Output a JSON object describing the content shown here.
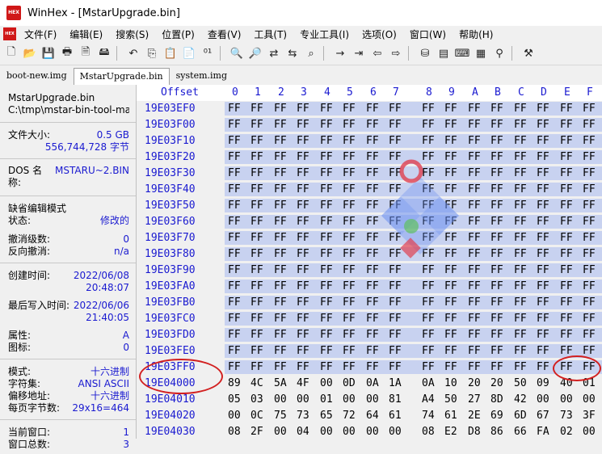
{
  "window": {
    "title": "WinHex - [MstarUpgrade.bin]",
    "icon_label": "HEX"
  },
  "menu": [
    "文件(F)",
    "编辑(E)",
    "搜索(S)",
    "位置(P)",
    "查看(V)",
    "工具(T)",
    "专业工具(I)",
    "选项(O)",
    "窗口(W)",
    "帮助(H)"
  ],
  "tabs": [
    {
      "label": "boot-new.img",
      "active": false
    },
    {
      "label": "MstarUpgrade.bin",
      "active": true
    },
    {
      "label": "system.img",
      "active": false
    }
  ],
  "info": {
    "filename": "MstarUpgrade.bin",
    "path": "C:\\tmp\\mstar-bin-tool-mas",
    "size_label": "文件大小:",
    "size_gb": "0.5 GB",
    "size_bytes": "556,744,728 字节",
    "dos_label": "DOS 名称:",
    "dos_value": "MSTARU~2.BIN",
    "edit_mode_label": "缺省编辑模式",
    "state_label": "状态:",
    "state_value": "修改的",
    "undo_label": "撤消级数:",
    "undo_value": "0",
    "redo_label": "反向撤消:",
    "redo_value": "n/a",
    "created_label": "创建时间:",
    "created_date": "2022/06/08",
    "created_time": "20:48:07",
    "modified_label": "最后写入时间:",
    "modified_date": "2022/06/06",
    "modified_time": "21:40:05",
    "attr_label": "属性:",
    "attr_value": "A",
    "icon_label": "图标:",
    "icon_value": "0",
    "mode_label": "模式:",
    "mode_value": "十六进制",
    "charset_label": "字符集:",
    "charset_value": "ANSI ASCII",
    "offset_label": "偏移地址:",
    "offset_value": "十六进制",
    "bpp_label": "每页字节数:",
    "bpp_value": "29x16=464",
    "curwin_label": "当前窗口:",
    "curwin_value": "1",
    "totwin_label": "窗口总数:",
    "totwin_value": "3"
  },
  "hex": {
    "header_offset": "Offset",
    "columns": [
      "0",
      "1",
      "2",
      "3",
      "4",
      "5",
      "6",
      "7",
      "8",
      "9",
      "A",
      "B",
      "C",
      "D",
      "E",
      "F"
    ],
    "rows": [
      {
        "offset": "19E03EF0",
        "bytes": [
          "FF",
          "FF",
          "FF",
          "FF",
          "FF",
          "FF",
          "FF",
          "FF",
          "FF",
          "FF",
          "FF",
          "FF",
          "FF",
          "FF",
          "FF",
          "FF"
        ]
      },
      {
        "offset": "19E03F00",
        "bytes": [
          "FF",
          "FF",
          "FF",
          "FF",
          "FF",
          "FF",
          "FF",
          "FF",
          "FF",
          "FF",
          "FF",
          "FF",
          "FF",
          "FF",
          "FF",
          "FF"
        ]
      },
      {
        "offset": "19E03F10",
        "bytes": [
          "FF",
          "FF",
          "FF",
          "FF",
          "FF",
          "FF",
          "FF",
          "FF",
          "FF",
          "FF",
          "FF",
          "FF",
          "FF",
          "FF",
          "FF",
          "FF"
        ]
      },
      {
        "offset": "19E03F20",
        "bytes": [
          "FF",
          "FF",
          "FF",
          "FF",
          "FF",
          "FF",
          "FF",
          "FF",
          "FF",
          "FF",
          "FF",
          "FF",
          "FF",
          "FF",
          "FF",
          "FF"
        ]
      },
      {
        "offset": "19E03F30",
        "bytes": [
          "FF",
          "FF",
          "FF",
          "FF",
          "FF",
          "FF",
          "FF",
          "FF",
          "FF",
          "FF",
          "FF",
          "FF",
          "FF",
          "FF",
          "FF",
          "FF"
        ]
      },
      {
        "offset": "19E03F40",
        "bytes": [
          "FF",
          "FF",
          "FF",
          "FF",
          "FF",
          "FF",
          "FF",
          "FF",
          "FF",
          "FF",
          "FF",
          "FF",
          "FF",
          "FF",
          "FF",
          "FF"
        ]
      },
      {
        "offset": "19E03F50",
        "bytes": [
          "FF",
          "FF",
          "FF",
          "FF",
          "FF",
          "FF",
          "FF",
          "FF",
          "FF",
          "FF",
          "FF",
          "FF",
          "FF",
          "FF",
          "FF",
          "FF"
        ]
      },
      {
        "offset": "19E03F60",
        "bytes": [
          "FF",
          "FF",
          "FF",
          "FF",
          "FF",
          "FF",
          "FF",
          "FF",
          "FF",
          "FF",
          "FF",
          "FF",
          "FF",
          "FF",
          "FF",
          "FF"
        ]
      },
      {
        "offset": "19E03F70",
        "bytes": [
          "FF",
          "FF",
          "FF",
          "FF",
          "FF",
          "FF",
          "FF",
          "FF",
          "FF",
          "FF",
          "FF",
          "FF",
          "FF",
          "FF",
          "FF",
          "FF"
        ]
      },
      {
        "offset": "19E03F80",
        "bytes": [
          "FF",
          "FF",
          "FF",
          "FF",
          "FF",
          "FF",
          "FF",
          "FF",
          "FF",
          "FF",
          "FF",
          "FF",
          "FF",
          "FF",
          "FF",
          "FF"
        ]
      },
      {
        "offset": "19E03F90",
        "bytes": [
          "FF",
          "FF",
          "FF",
          "FF",
          "FF",
          "FF",
          "FF",
          "FF",
          "FF",
          "FF",
          "FF",
          "FF",
          "FF",
          "FF",
          "FF",
          "FF"
        ]
      },
      {
        "offset": "19E03FA0",
        "bytes": [
          "FF",
          "FF",
          "FF",
          "FF",
          "FF",
          "FF",
          "FF",
          "FF",
          "FF",
          "FF",
          "FF",
          "FF",
          "FF",
          "FF",
          "FF",
          "FF"
        ]
      },
      {
        "offset": "19E03FB0",
        "bytes": [
          "FF",
          "FF",
          "FF",
          "FF",
          "FF",
          "FF",
          "FF",
          "FF",
          "FF",
          "FF",
          "FF",
          "FF",
          "FF",
          "FF",
          "FF",
          "FF"
        ]
      },
      {
        "offset": "19E03FC0",
        "bytes": [
          "FF",
          "FF",
          "FF",
          "FF",
          "FF",
          "FF",
          "FF",
          "FF",
          "FF",
          "FF",
          "FF",
          "FF",
          "FF",
          "FF",
          "FF",
          "FF"
        ]
      },
      {
        "offset": "19E03FD0",
        "bytes": [
          "FF",
          "FF",
          "FF",
          "FF",
          "FF",
          "FF",
          "FF",
          "FF",
          "FF",
          "FF",
          "FF",
          "FF",
          "FF",
          "FF",
          "FF",
          "FF"
        ]
      },
      {
        "offset": "19E03FE0",
        "bytes": [
          "FF",
          "FF",
          "FF",
          "FF",
          "FF",
          "FF",
          "FF",
          "FF",
          "FF",
          "FF",
          "FF",
          "FF",
          "FF",
          "FF",
          "FF",
          "FF"
        ]
      },
      {
        "offset": "19E03FF0",
        "bytes": [
          "FF",
          "FF",
          "FF",
          "FF",
          "FF",
          "FF",
          "FF",
          "FF",
          "FF",
          "FF",
          "FF",
          "FF",
          "FF",
          "FF",
          "FF",
          "FF"
        ]
      },
      {
        "offset": "19E04000",
        "bytes": [
          "89",
          "4C",
          "5A",
          "4F",
          "00",
          "0D",
          "0A",
          "1A",
          "0A",
          "10",
          "20",
          "20",
          "50",
          "09",
          "40",
          "01"
        ]
      },
      {
        "offset": "19E04010",
        "bytes": [
          "05",
          "03",
          "00",
          "00",
          "01",
          "00",
          "00",
          "81",
          "A4",
          "50",
          "27",
          "8D",
          "42",
          "00",
          "00",
          "00"
        ]
      },
      {
        "offset": "19E04020",
        "bytes": [
          "00",
          "0C",
          "75",
          "73",
          "65",
          "72",
          "64",
          "61",
          "74",
          "61",
          "2E",
          "69",
          "6D",
          "67",
          "73",
          "3F"
        ]
      },
      {
        "offset": "19E04030",
        "bytes": [
          "08",
          "2F",
          "00",
          "04",
          "00",
          "00",
          "00",
          "00",
          "08",
          "E2",
          "D8",
          "86",
          "66",
          "FA",
          "02",
          "00"
        ]
      }
    ],
    "selected_rows": 17
  },
  "colors": {
    "accent": "#1a1ad0",
    "selection": "#c8d2f0",
    "annotation": "#d22020"
  }
}
